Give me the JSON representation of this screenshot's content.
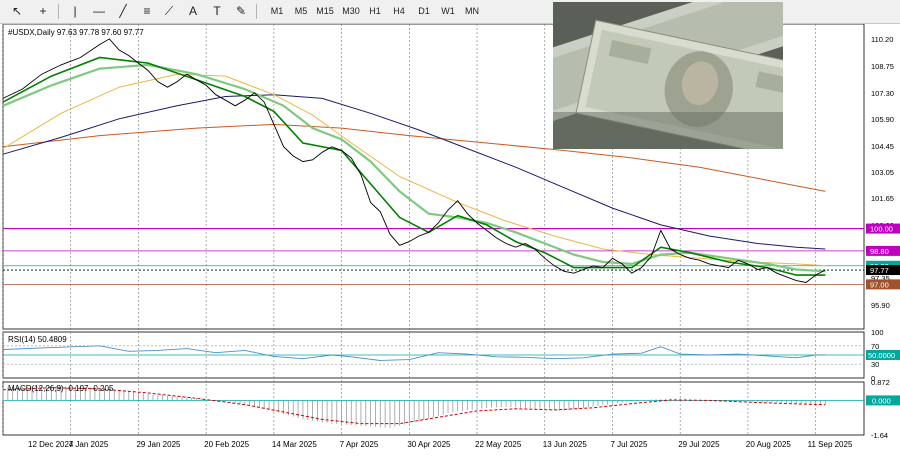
{
  "toolbar": {
    "tools": [
      {
        "name": "cursor-icon",
        "glyph": "↖"
      },
      {
        "name": "crosshair-icon",
        "glyph": "+"
      },
      {
        "name": "vertical-line-icon",
        "glyph": "|"
      },
      {
        "name": "horizontal-line-icon",
        "glyph": "—"
      },
      {
        "name": "trendline-icon",
        "glyph": "╱"
      },
      {
        "name": "fibonacci-icon",
        "glyph": "≡"
      },
      {
        "name": "gann-fan-icon",
        "glyph": "⟋"
      },
      {
        "name": "text-icon",
        "glyph": "A"
      },
      {
        "name": "text-label-icon",
        "glyph": "T"
      },
      {
        "name": "shapes-icon",
        "glyph": "✎"
      }
    ],
    "timeframes": [
      "M1",
      "M5",
      "M15",
      "M30",
      "H1",
      "H4",
      "D1",
      "W1",
      "MN"
    ]
  },
  "chart_data": {
    "type": "line",
    "symbol_header": "#USDX,Daily  97.63 97.78 97.60 97.77",
    "main": {
      "ylim": [
        94.6,
        111.0
      ],
      "y_ticks": [
        "110.20",
        "108.75",
        "107.30",
        "105.90",
        "104.45",
        "103.05",
        "101.65",
        "100.20",
        "98.80",
        "97.35",
        "95.90"
      ],
      "x_ticks": [
        "12 Dec 2024",
        "7 Jan 2025",
        "29 Jan 2025",
        "20 Feb 2025",
        "14 Mar 2025",
        "7 Apr 2025",
        "30 Apr 2025",
        "22 May 2025",
        "13 Jun 2025",
        "7 Jul 2025",
        "29 Jul 2025",
        "20 Aug 2025",
        "11 Sep 2025"
      ],
      "price_close": [
        [
          0,
          107.0
        ],
        [
          4,
          107.5
        ],
        [
          8,
          108.3
        ],
        [
          12,
          108.8
        ],
        [
          16,
          109.2
        ],
        [
          20,
          109.9
        ],
        [
          22,
          110.2
        ],
        [
          24,
          109.6
        ],
        [
          26,
          109.3
        ],
        [
          28,
          108.9
        ],
        [
          30,
          108.5
        ],
        [
          32,
          107.9
        ],
        [
          34,
          107.6
        ],
        [
          36,
          107.9
        ],
        [
          38,
          108.3
        ],
        [
          40,
          108.0
        ],
        [
          42,
          107.7
        ],
        [
          44,
          107.2
        ],
        [
          46,
          106.9
        ],
        [
          48,
          106.6
        ],
        [
          50,
          106.9
        ],
        [
          52,
          107.3
        ],
        [
          54,
          106.8
        ],
        [
          56,
          105.6
        ],
        [
          58,
          104.4
        ],
        [
          60,
          103.9
        ],
        [
          62,
          103.6
        ],
        [
          64,
          103.7
        ],
        [
          66,
          104.1
        ],
        [
          68,
          104.4
        ],
        [
          70,
          104.2
        ],
        [
          72,
          103.8
        ],
        [
          74,
          102.9
        ],
        [
          76,
          101.4
        ],
        [
          78,
          100.9
        ],
        [
          80,
          99.7
        ],
        [
          82,
          99.1
        ],
        [
          84,
          99.3
        ],
        [
          86,
          99.6
        ],
        [
          88,
          99.8
        ],
        [
          90,
          100.3
        ],
        [
          92,
          101.0
        ],
        [
          94,
          101.5
        ],
        [
          96,
          100.8
        ],
        [
          98,
          100.3
        ],
        [
          100,
          99.9
        ],
        [
          102,
          99.5
        ],
        [
          104,
          99.2
        ],
        [
          106,
          99.0
        ],
        [
          108,
          99.2
        ],
        [
          110,
          98.9
        ],
        [
          112,
          98.4
        ],
        [
          114,
          98.0
        ],
        [
          116,
          97.7
        ],
        [
          118,
          97.6
        ],
        [
          120,
          97.8
        ],
        [
          122,
          98.0
        ],
        [
          124,
          97.9
        ],
        [
          126,
          98.4
        ],
        [
          128,
          98.1
        ],
        [
          130,
          97.6
        ],
        [
          132,
          97.9
        ],
        [
          134,
          98.5
        ],
        [
          136,
          99.9
        ],
        [
          138,
          98.9
        ],
        [
          140,
          98.6
        ],
        [
          142,
          98.4
        ],
        [
          144,
          98.3
        ],
        [
          146,
          98.1
        ],
        [
          148,
          98.0
        ],
        [
          150,
          97.9
        ],
        [
          152,
          98.3
        ],
        [
          154,
          98.1
        ],
        [
          156,
          97.8
        ],
        [
          158,
          97.9
        ],
        [
          160,
          97.6
        ],
        [
          162,
          97.4
        ],
        [
          164,
          97.2
        ],
        [
          166,
          97.1
        ],
        [
          168,
          97.5
        ],
        [
          170,
          97.77
        ]
      ],
      "ma_fast": [
        [
          0,
          106.8
        ],
        [
          10,
          108.2
        ],
        [
          20,
          109.2
        ],
        [
          30,
          108.9
        ],
        [
          40,
          108.0
        ],
        [
          50,
          107.1
        ],
        [
          56,
          106.3
        ],
        [
          62,
          104.6
        ],
        [
          70,
          104.2
        ],
        [
          76,
          102.4
        ],
        [
          82,
          100.6
        ],
        [
          88,
          99.8
        ],
        [
          94,
          100.7
        ],
        [
          100,
          100.2
        ],
        [
          106,
          99.3
        ],
        [
          112,
          98.7
        ],
        [
          118,
          97.9
        ],
        [
          124,
          97.9
        ],
        [
          130,
          97.9
        ],
        [
          136,
          99.0
        ],
        [
          142,
          98.7
        ],
        [
          150,
          98.2
        ],
        [
          158,
          97.9
        ],
        [
          164,
          97.5
        ],
        [
          170,
          97.5
        ]
      ],
      "ma_slow": [
        [
          0,
          106.6
        ],
        [
          10,
          107.7
        ],
        [
          20,
          108.6
        ],
        [
          30,
          108.8
        ],
        [
          40,
          108.3
        ],
        [
          50,
          107.5
        ],
        [
          58,
          106.6
        ],
        [
          64,
          105.4
        ],
        [
          70,
          104.8
        ],
        [
          76,
          103.6
        ],
        [
          82,
          102.0
        ],
        [
          88,
          100.8
        ],
        [
          94,
          100.6
        ],
        [
          100,
          100.3
        ],
        [
          106,
          99.8
        ],
        [
          112,
          99.2
        ],
        [
          118,
          98.6
        ],
        [
          124,
          98.2
        ],
        [
          130,
          98.1
        ],
        [
          136,
          98.6
        ],
        [
          142,
          98.7
        ],
        [
          150,
          98.4
        ],
        [
          158,
          98.1
        ],
        [
          164,
          97.8
        ],
        [
          170,
          97.7
        ]
      ],
      "ma_50": [
        [
          0,
          104.3
        ],
        [
          12,
          106.2
        ],
        [
          24,
          107.6
        ],
        [
          36,
          108.3
        ],
        [
          46,
          108.2
        ],
        [
          56,
          107.2
        ],
        [
          64,
          106.1
        ],
        [
          72,
          104.6
        ],
        [
          82,
          102.8
        ],
        [
          94,
          101.4
        ],
        [
          104,
          100.4
        ],
        [
          114,
          99.6
        ],
        [
          124,
          98.9
        ],
        [
          134,
          98.6
        ],
        [
          144,
          98.4
        ],
        [
          154,
          98.2
        ],
        [
          164,
          98.1
        ],
        [
          170,
          98.0
        ]
      ],
      "ma_100": [
        [
          0,
          104.0
        ],
        [
          12,
          104.9
        ],
        [
          24,
          105.9
        ],
        [
          36,
          106.6
        ],
        [
          46,
          107.1
        ],
        [
          56,
          107.2
        ],
        [
          66,
          107.0
        ],
        [
          76,
          106.2
        ],
        [
          86,
          105.3
        ],
        [
          96,
          104.3
        ],
        [
          106,
          103.3
        ],
        [
          116,
          102.2
        ],
        [
          126,
          101.1
        ],
        [
          136,
          100.2
        ],
        [
          146,
          99.6
        ],
        [
          156,
          99.2
        ],
        [
          164,
          99.0
        ],
        [
          170,
          98.9
        ]
      ],
      "ma_200": [
        [
          0,
          104.4
        ],
        [
          20,
          105.0
        ],
        [
          40,
          105.4
        ],
        [
          56,
          105.6
        ],
        [
          70,
          105.4
        ],
        [
          84,
          105.0
        ],
        [
          100,
          104.6
        ],
        [
          116,
          104.2
        ],
        [
          130,
          103.8
        ],
        [
          144,
          103.3
        ],
        [
          158,
          102.6
        ],
        [
          170,
          102.0
        ]
      ],
      "levels": [
        {
          "label": "100.00",
          "value": 100.0,
          "color": "#c000c0"
        },
        {
          "label": "98.80",
          "value": 98.8,
          "color": "#c000c0"
        },
        {
          "label": "98.00",
          "value": 98.0,
          "color": "#00a9a0"
        },
        {
          "label": "97.77",
          "value": 97.77,
          "color": "#000000"
        },
        {
          "label": "97.00",
          "value": 97.0,
          "color": "#a0522d"
        }
      ]
    },
    "rsi": {
      "label": "RSI(14) 50.4809",
      "ylim": [
        0,
        100
      ],
      "y_ticks": [
        "100",
        "70",
        "30",
        "0"
      ],
      "level_label": "50.0000",
      "values": [
        [
          0,
          62
        ],
        [
          10,
          66
        ],
        [
          20,
          70
        ],
        [
          26,
          58
        ],
        [
          32,
          60
        ],
        [
          38,
          64
        ],
        [
          44,
          55
        ],
        [
          50,
          60
        ],
        [
          56,
          47
        ],
        [
          62,
          42
        ],
        [
          68,
          50
        ],
        [
          72,
          46
        ],
        [
          78,
          38
        ],
        [
          84,
          40
        ],
        [
          90,
          55
        ],
        [
          96,
          52
        ],
        [
          102,
          46
        ],
        [
          108,
          45
        ],
        [
          114,
          42
        ],
        [
          120,
          44
        ],
        [
          126,
          52
        ],
        [
          132,
          54
        ],
        [
          136,
          68
        ],
        [
          140,
          52
        ],
        [
          146,
          50
        ],
        [
          152,
          52
        ],
        [
          158,
          48
        ],
        [
          164,
          44
        ],
        [
          168,
          50
        ],
        [
          170,
          50.48
        ]
      ]
    },
    "macd": {
      "label": "MACD(12,26,9) -0.197 -0.205",
      "ylim": [
        -1.64,
        0.872
      ],
      "y_ticks": [
        "0.872",
        "0.000",
        "-1.64"
      ],
      "level_label": "0.000",
      "histogram": [
        [
          0,
          0.6
        ],
        [
          10,
          0.7
        ],
        [
          20,
          0.6
        ],
        [
          30,
          0.3
        ],
        [
          40,
          0.1
        ],
        [
          50,
          -0.2
        ],
        [
          56,
          -0.5
        ],
        [
          62,
          -0.9
        ],
        [
          68,
          -1.1
        ],
        [
          74,
          -1.2
        ],
        [
          80,
          -1.3
        ],
        [
          86,
          -1.0
        ],
        [
          92,
          -0.6
        ],
        [
          98,
          -0.4
        ],
        [
          104,
          -0.3
        ],
        [
          110,
          -0.4
        ],
        [
          116,
          -0.5
        ],
        [
          122,
          -0.3
        ],
        [
          128,
          -0.1
        ],
        [
          134,
          0.05
        ],
        [
          140,
          0.1
        ],
        [
          146,
          0.0
        ],
        [
          152,
          -0.05
        ],
        [
          158,
          -0.1
        ],
        [
          164,
          -0.15
        ],
        [
          170,
          -0.197
        ]
      ],
      "signal": [
        [
          0,
          0.5
        ],
        [
          10,
          0.6
        ],
        [
          20,
          0.55
        ],
        [
          30,
          0.35
        ],
        [
          40,
          0.1
        ],
        [
          50,
          -0.2
        ],
        [
          58,
          -0.55
        ],
        [
          66,
          -0.9
        ],
        [
          74,
          -1.1
        ],
        [
          82,
          -1.1
        ],
        [
          90,
          -0.8
        ],
        [
          98,
          -0.5
        ],
        [
          106,
          -0.4
        ],
        [
          114,
          -0.45
        ],
        [
          122,
          -0.35
        ],
        [
          130,
          -0.15
        ],
        [
          138,
          0.02
        ],
        [
          146,
          0.0
        ],
        [
          154,
          -0.08
        ],
        [
          162,
          -0.15
        ],
        [
          170,
          -0.205
        ]
      ]
    },
    "colors": {
      "price": "#000000",
      "ma_fast": "#008000",
      "ma_slow": "#7fc97f",
      "ma_50": "#e8b84a",
      "ma_100": "#1a1a6e",
      "ma_200": "#cc5a1e",
      "rsi": "#4a90c8",
      "macd_hist": "#9a9a9a",
      "macd_signal": "#cc0000",
      "level_zero": "#00a9a0"
    }
  }
}
